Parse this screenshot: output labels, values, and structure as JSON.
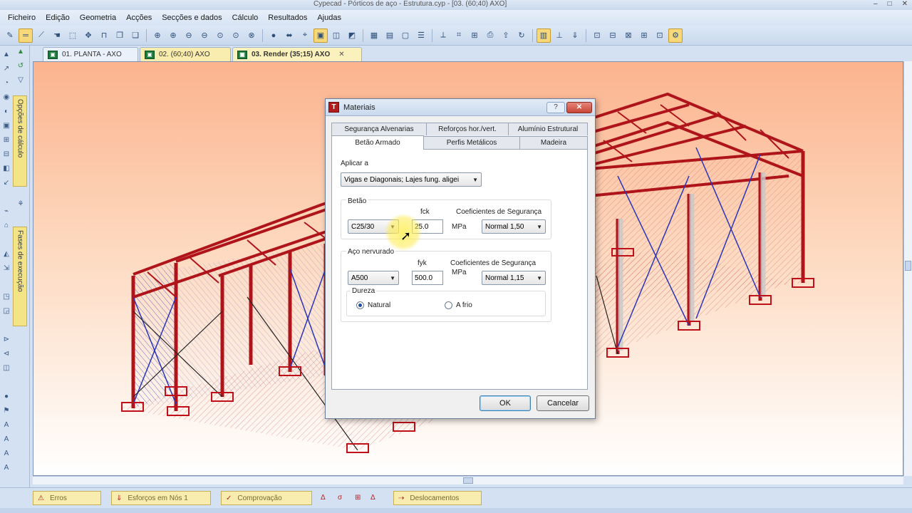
{
  "window": {
    "title": "Cypecad - Pórticos de aço - Estrutura.cyp - [03. (60;40) AXO]",
    "buttons": [
      "–",
      "□",
      "✕"
    ]
  },
  "menu": [
    "Ficheiro",
    "Edição",
    "Geometria",
    "Acções",
    "Secções e dados",
    "Cálculo",
    "Resultados",
    "Ajudas"
  ],
  "left_panels": {
    "options": "Opções de cálculo",
    "phases": "Fases de execução"
  },
  "doc_tabs": [
    {
      "label": "01. PLANTA - AXO"
    },
    {
      "label": "02. (60;40) AXO"
    },
    {
      "label": "03. Render (35;15) AXO",
      "close": "✕"
    }
  ],
  "bottom_tabs": {
    "erros": "Erros",
    "esforcos": "Esforços em Nós 1",
    "comprovacao": "Comprovação",
    "deslocamentos": "Deslocamentos"
  },
  "dialog": {
    "title": "Materiais",
    "help_button": "?",
    "close_button": "✕",
    "tabs_row1": [
      "Segurança Alvenarias",
      "Reforços hor./vert.",
      "Alumínio Estrutural"
    ],
    "tabs_row2": [
      "Betão Armado",
      "Perfis Metálicos",
      "Madeira"
    ],
    "selected_tab": "Betão Armado",
    "apply_to_label": "Aplicar a",
    "apply_to_value": "Vigas e Diagonais; Lajes fung. aligei",
    "concrete": {
      "group_label": "Betão",
      "grade": "C25/30",
      "fck_label": "fck",
      "fck_value": "25.0",
      "unit": "MPa",
      "safety_label": "Coeficientes de Segurança",
      "safety_value": "Normal 1,50"
    },
    "steel": {
      "group_label": "Aço nervurado",
      "grade": "A500",
      "fyk_label": "fyk",
      "fyk_value": "500.0",
      "unit": "MPa",
      "safety_label": "Coeficientes de Segurança",
      "safety_value": "Normal 1,15",
      "hardness_label": "Dureza",
      "hardness_options": [
        "Natural",
        "A frio"
      ],
      "hardness_selected": "Natural"
    },
    "ok_button": "OK",
    "cancel_button": "Cancelar"
  },
  "colors": {
    "accent_yellow": "#f3e486",
    "frame_red": "#b0141b",
    "bracing_blue": "#2a36b8",
    "viewport_top": "#fbb38e"
  }
}
